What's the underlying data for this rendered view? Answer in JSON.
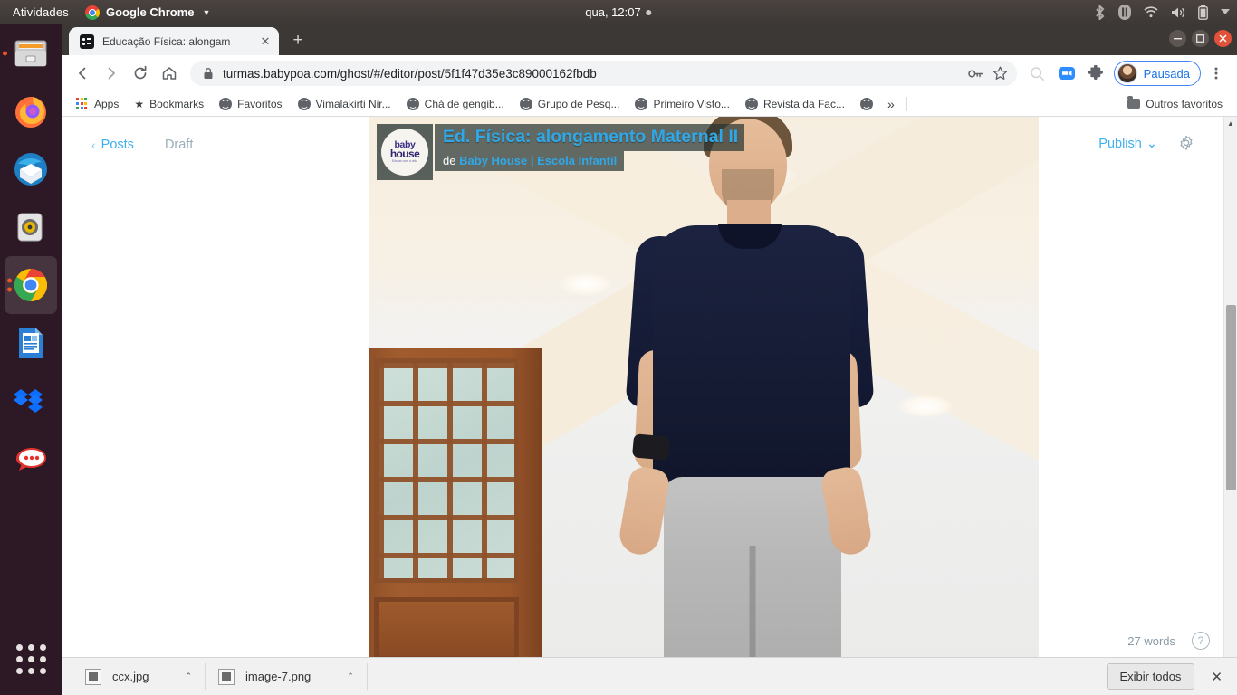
{
  "desktop": {
    "activities": "Atividades",
    "app_menu": "Google Chrome",
    "clock": "qua, 12:07",
    "tray_icons": [
      "bluetooth-icon",
      "pause-indicator-icon",
      "wifi-icon",
      "volume-icon",
      "battery-icon",
      "chevron-down-icon"
    ],
    "dock_items": [
      {
        "name": "files",
        "label": "Arquivos"
      },
      {
        "name": "firefox",
        "label": "Firefox"
      },
      {
        "name": "thunderbird",
        "label": "Thunderbird"
      },
      {
        "name": "rhythmbox",
        "label": "Rhythmbox"
      },
      {
        "name": "google-chrome",
        "label": "Google Chrome"
      },
      {
        "name": "libreoffice-writer",
        "label": "LibreOffice Writer"
      },
      {
        "name": "dropbox",
        "label": "Dropbox"
      },
      {
        "name": "rocketchat",
        "label": "Rocket.Chat"
      }
    ],
    "show_applications": "Mostrar aplicativos"
  },
  "browser": {
    "tab": {
      "title": "Educação Física: alongam",
      "favicon": "ghost-icon",
      "close_label": "✕"
    },
    "new_tab_label": "+",
    "window_controls": {
      "minimize": "—",
      "maximize": "▢",
      "close": "✕"
    },
    "nav": {
      "back": "‹",
      "forward": "›",
      "reload": "⟳",
      "home": "⌂"
    },
    "omnibox": {
      "lock_icon": "lock-icon",
      "url_host": "turmas.babypoa.com",
      "url_path": "/ghost/#/editor/post/5f1f47d35e3c89000162fbdb",
      "url_full": "turmas.babypoa.com/ghost/#/editor/post/5f1f47d35e3c89000162fbdb"
    },
    "omni_actions": [
      "key-icon",
      "star-icon"
    ],
    "toolbar_icons": [
      "search-disabled-icon",
      "zoom-video-icon",
      "extensions-puzzle-icon"
    ],
    "profile": {
      "label": "Pausada",
      "avatar": "user-avatar"
    },
    "menu_label": "⋮",
    "bookmarks": [
      {
        "label": "Apps",
        "icon": "apps-grid-icon"
      },
      {
        "label": "Bookmarks",
        "icon": "star-icon"
      },
      {
        "label": "Favoritos",
        "icon": "globe-icon"
      },
      {
        "label": "Vimalakirti Nir...",
        "icon": "globe-icon"
      },
      {
        "label": "Chá de gengib...",
        "icon": "globe-icon"
      },
      {
        "label": "Grupo de Pesq...",
        "icon": "globe-icon"
      },
      {
        "label": "Primeiro Visto...",
        "icon": "globe-icon"
      },
      {
        "label": "Revista da Fac...",
        "icon": "globe-icon"
      },
      {
        "label": "",
        "icon": "globe-icon"
      }
    ],
    "bookmarks_overflow": "»",
    "other_bookmarks": "Outros favoritos"
  },
  "editor": {
    "back_label": "Posts",
    "back_chevron": "‹",
    "status": "Draft",
    "publish_label": "Publish",
    "publish_caret": "⌄",
    "settings_icon": "gear-icon",
    "word_count": "27 words",
    "help_icon": "help-circle-icon"
  },
  "embed": {
    "logo_lines": [
      "baby",
      "house",
      "Educar com a vida"
    ],
    "title": "Ed. Física: alongamento Maternal II",
    "byline_prefix": "de",
    "channel": "Baby House | Escola Infantil",
    "accent_color": "#2fa8e8"
  },
  "downloads": [
    {
      "filename": "ccx.jpg",
      "caret": "⌃"
    },
    {
      "filename": "image-7.png",
      "caret": "⌃"
    }
  ],
  "shelf": {
    "show_all": "Exibir todos",
    "close": "✕"
  }
}
